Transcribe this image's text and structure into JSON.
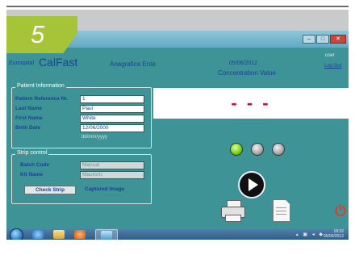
{
  "step": {
    "number": "5"
  },
  "window": {
    "buttons": [
      "–",
      "□",
      "✕"
    ]
  },
  "header": {
    "brand_small": "Eurospital",
    "brand_big": "CalFast",
    "section": "Anagrafica Ente",
    "date": "05/06/2012",
    "user_label": "user",
    "logout": "Log Out"
  },
  "concentration": {
    "title": "Concentration Value",
    "value": "- - -"
  },
  "patient": {
    "legend": "Patient Information",
    "ref_label": "Patient Reference Nr.",
    "ref_value": "1",
    "last_label": "Last Name",
    "last_value": "Paul",
    "first_label": "First Name",
    "first_value": "White",
    "birth_label": "Birth Date",
    "birth_value": "12/06/2000",
    "date_hint": "dd/mm/yyyy"
  },
  "strip": {
    "legend": "Strip control",
    "batch_label": "Batch Code",
    "batch_value": "Manual",
    "kit_label": "Kit Name",
    "kit_value": "Maurizio",
    "check_button": "Check Strip",
    "captured_label": "Captured Image"
  },
  "status_leds": [
    "green",
    "grey",
    "grey"
  ],
  "icons": {
    "play": "play-icon",
    "print": "printer-icon",
    "document": "document-icon",
    "power": "power-icon"
  },
  "taskbar": {
    "time": "18:32",
    "date": "05/06/2012"
  },
  "colors": {
    "app_bg": "#3e9397",
    "accent": "#a5c438",
    "value_red": "#b5152b",
    "label_blue": "#1d3f9a"
  }
}
